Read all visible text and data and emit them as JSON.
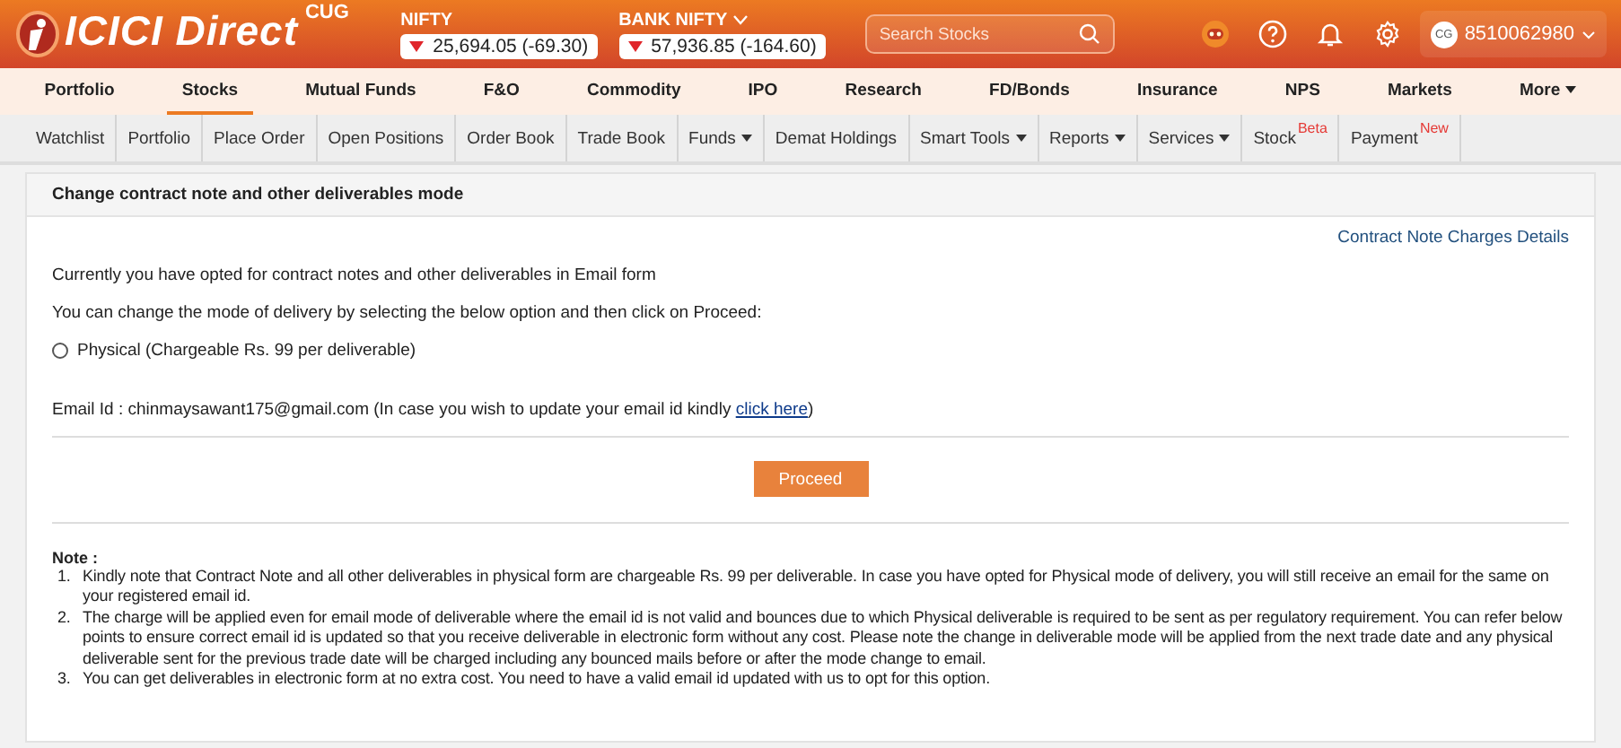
{
  "header": {
    "logo_text": "ICICI Direct",
    "badge": "CUG",
    "indices": [
      {
        "name": "NIFTY",
        "dropdown": false,
        "falling": true,
        "value": "25,694.05 (-69.30)"
      },
      {
        "name": "BANK NIFTY",
        "dropdown": true,
        "falling": true,
        "value": "57,936.85 (-164.60)"
      }
    ],
    "search": {
      "placeholder": "Search Stocks"
    },
    "user": {
      "initials": "CG",
      "id": "8510062980"
    }
  },
  "main_nav": [
    {
      "label": "Portfolio",
      "selected": false,
      "dropdown": false
    },
    {
      "label": "Stocks",
      "selected": true,
      "dropdown": false
    },
    {
      "label": "Mutual Funds",
      "selected": false,
      "dropdown": false
    },
    {
      "label": "F&O",
      "selected": false,
      "dropdown": false
    },
    {
      "label": "Commodity",
      "selected": false,
      "dropdown": false
    },
    {
      "label": "IPO",
      "selected": false,
      "dropdown": false
    },
    {
      "label": "Research",
      "selected": false,
      "dropdown": false
    },
    {
      "label": "FD/Bonds",
      "selected": false,
      "dropdown": false
    },
    {
      "label": "Insurance",
      "selected": false,
      "dropdown": false
    },
    {
      "label": "NPS",
      "selected": false,
      "dropdown": false
    },
    {
      "label": "Markets",
      "selected": false,
      "dropdown": false
    },
    {
      "label": "More",
      "selected": false,
      "dropdown": true
    }
  ],
  "sub_nav": [
    {
      "label": "Watchlist",
      "dropdown": false
    },
    {
      "label": "Portfolio",
      "dropdown": false
    },
    {
      "label": "Place Order",
      "dropdown": false
    },
    {
      "label": "Open Positions",
      "dropdown": false
    },
    {
      "label": "Order Book",
      "dropdown": false
    },
    {
      "label": "Trade Book",
      "dropdown": false
    },
    {
      "label": "Funds",
      "dropdown": true
    },
    {
      "label": "Demat Holdings",
      "dropdown": false
    },
    {
      "label": "Smart Tools",
      "dropdown": true
    },
    {
      "label": "Reports",
      "dropdown": true
    },
    {
      "label": "Services",
      "dropdown": true
    },
    {
      "label": "Stock",
      "dropdown": false,
      "tag": "Beta"
    },
    {
      "label": "Payment",
      "dropdown": false,
      "tag": "New"
    }
  ],
  "panel": {
    "title": "Change contract note and other deliverables mode",
    "charges_link": "Contract Note Charges Details",
    "paragraphs": [
      "Currently you have opted for contract notes and other deliverables in Email form",
      "You can change the mode of delivery by selecting the below option and then click on Proceed:"
    ],
    "options": [
      {
        "label": "Physical (Chargeable Rs. 99 per deliverable)",
        "selected": false
      }
    ],
    "email_line": {
      "text": "Email Id : chinmaysawant175@gmail.com (In case you wish to update your email id kindly ",
      "link": "click here",
      "suffix": ")"
    },
    "button": "Proceed",
    "note_title": "Note :",
    "notes": [
      {
        "number": "1.",
        "text": "Kindly note that Contract Note and all other deliverables in physical form are chargeable Rs. 99 per deliverable. In case you have opted for Physical mode of delivery, you will still receive an email for the same on your registered email id."
      },
      {
        "number": "2.",
        "text": "The charge will be applied even for email mode of deliverable where the email id is not valid and bounces due to which Physical deliverable is required to be sent as per regulatory requirement. You can refer below points to ensure correct email id is updated so that you receive deliverable in electronic form without any cost. Please note the change in deliverable mode will be applied from the next trade date and any physical deliverable sent for the previous trade date will be charged including any bounced mails before or after the mode change to email."
      },
      {
        "number": "3.",
        "text": "You can get deliverables in electronic form at no extra cost. You need to have a valid email id updated with us to opt for this option."
      }
    ]
  }
}
